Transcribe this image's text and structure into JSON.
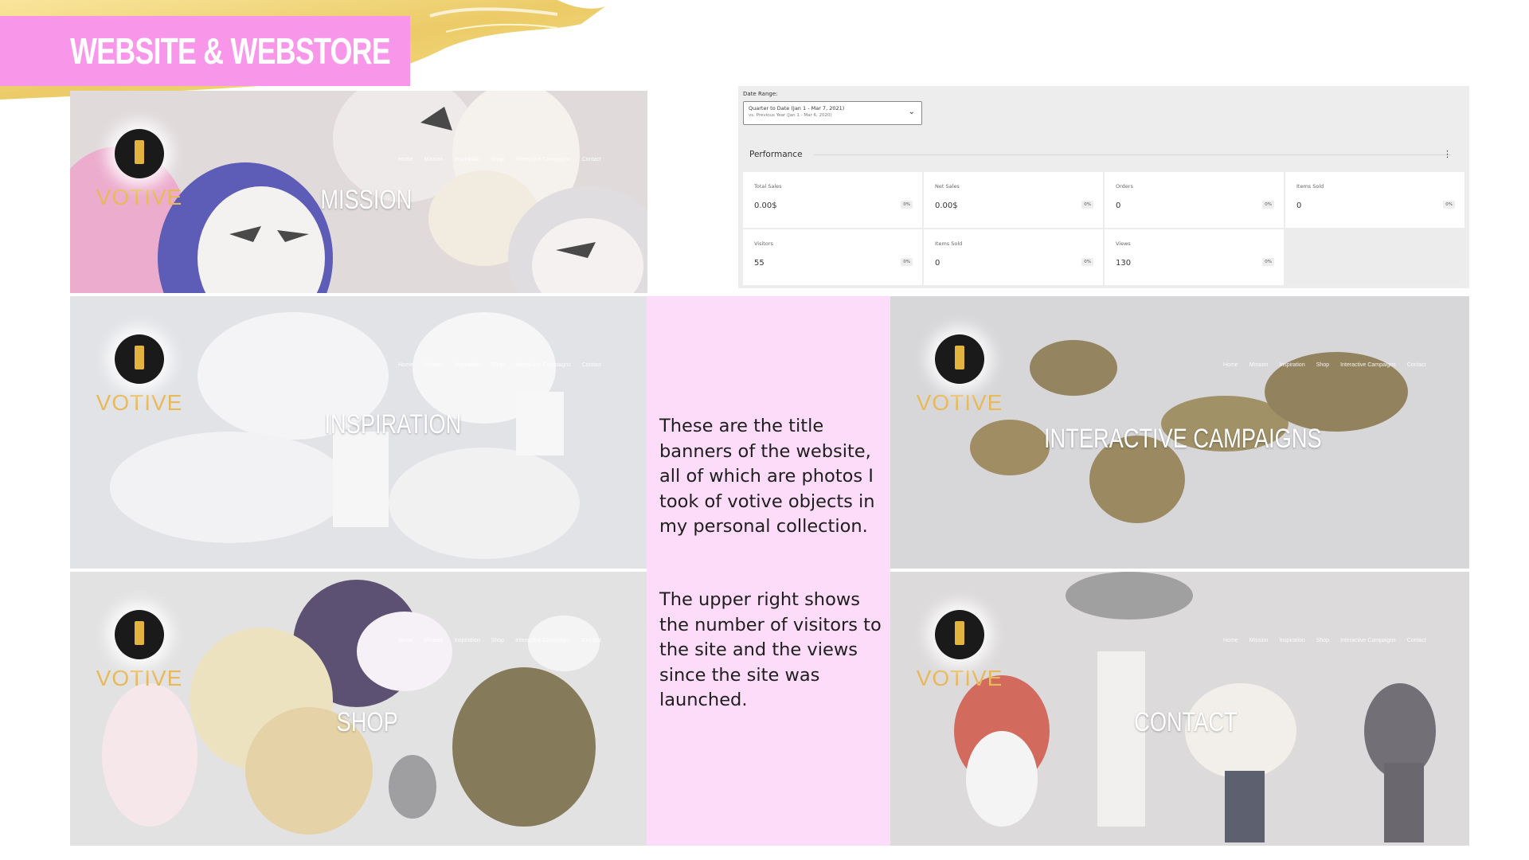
{
  "slide": {
    "title": "WEBSITE & WEBSTORE",
    "accent_color": "#f896ea",
    "panel_color": "#fcdcf8"
  },
  "banners": [
    {
      "id": "mission",
      "title": "MISSION",
      "logo": "VOTIVE",
      "nav": [
        "Home",
        "Mission",
        "Inspiration",
        "Shop",
        "Interactive Campaigns",
        "Contact"
      ]
    },
    {
      "id": "inspiration",
      "title": "INSPIRATION",
      "logo": "VOTIVE",
      "nav": [
        "Home",
        "Mission",
        "Inspiration",
        "Shop",
        "Interactive Campaigns",
        "Contact"
      ]
    },
    {
      "id": "interactive",
      "title": "INTERACTIVE CAMPAIGNS",
      "logo": "VOTIVE",
      "nav": [
        "Home",
        "Mission",
        "Inspiration",
        "Shop",
        "Interactive Campaigns",
        "Contact"
      ]
    },
    {
      "id": "shop",
      "title": "SHOP",
      "logo": "VOTIVE",
      "nav": [
        "Home",
        "Mission",
        "Inspiration",
        "Shop",
        "Interactive Campaigns",
        "Contact"
      ]
    },
    {
      "id": "contact",
      "title": "CONTACT",
      "logo": "VOTIVE",
      "nav": [
        "Home",
        "Mission",
        "Inspiration",
        "Shop",
        "Interactive Campaigns",
        "Contact"
      ]
    }
  ],
  "description": {
    "paragraph1": "These are the title banners of the website, all of which are photos I took of votive objects in my personal collection.",
    "paragraph2": "The upper right shows the number of visitors to the site and the views since the site was launched."
  },
  "dashboard": {
    "date_range_label": "Date Range:",
    "date_range_value": "Quarter to Date (Jan 1 - Mar 7, 2021)",
    "date_range_compare": "vs. Previous Year (Jan 1 - Mar 6, 2020)",
    "section_title": "Performance",
    "metrics": [
      {
        "label": "Total Sales",
        "value": "0.00$",
        "change": "0%"
      },
      {
        "label": "Net Sales",
        "value": "0.00$",
        "change": "0%"
      },
      {
        "label": "Orders",
        "value": "0",
        "change": "0%"
      },
      {
        "label": "Items Sold",
        "value": "0",
        "change": "0%"
      },
      {
        "label": "Visitors",
        "value": "55",
        "change": "0%"
      },
      {
        "label": "Items Sold",
        "value": "0",
        "change": "0%"
      },
      {
        "label": "Views",
        "value": "130",
        "change": "0%"
      }
    ]
  }
}
